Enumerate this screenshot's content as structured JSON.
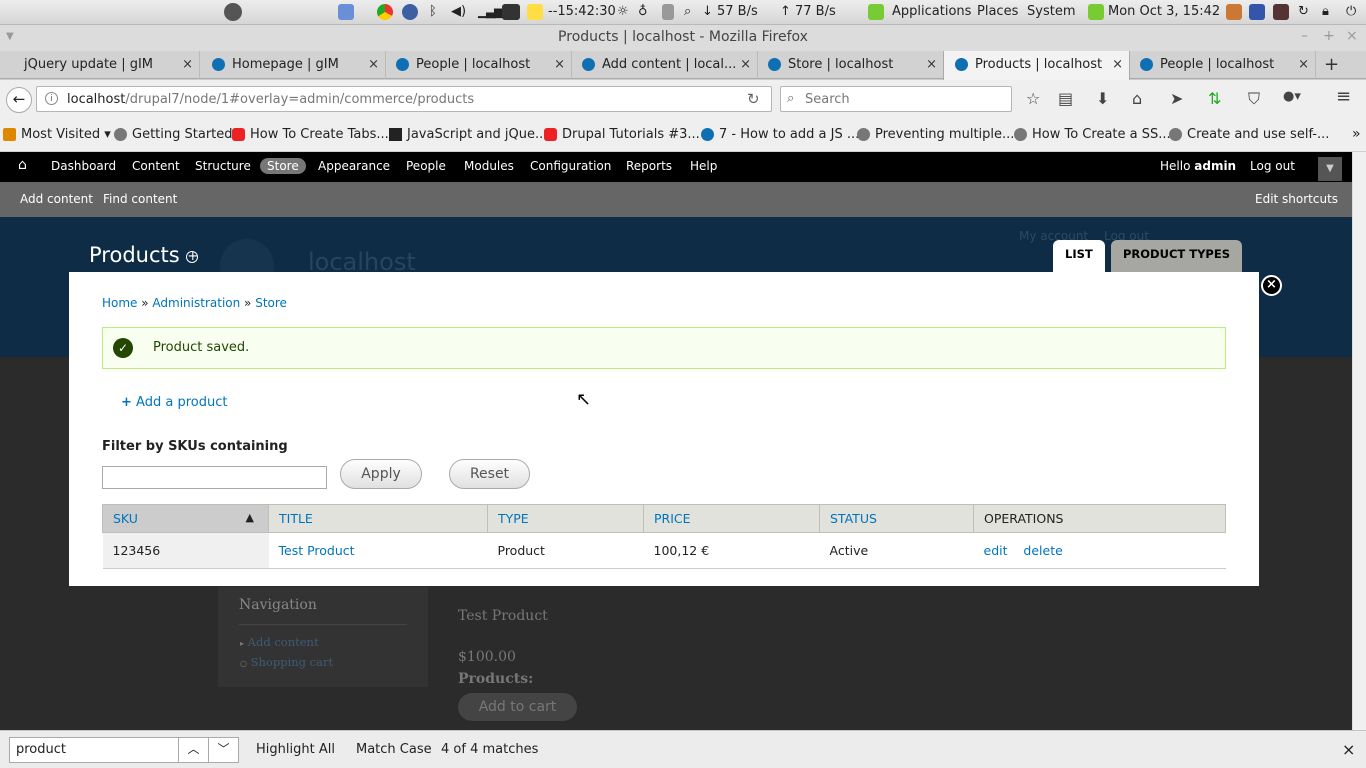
{
  "system": {
    "clock_left": "--15:42:30",
    "net_down": "57 B/s",
    "net_up": "77 B/s",
    "menu": [
      "Applications",
      "Places",
      "System"
    ],
    "datetime": "Mon Oct  3, 15:42"
  },
  "window": {
    "title": "Products | localhost - Mozilla Firefox"
  },
  "tabs": [
    {
      "label": "jQuery update | gIM"
    },
    {
      "label": "Homepage | gIM"
    },
    {
      "label": "People | localhost"
    },
    {
      "label": "Add content | local..."
    },
    {
      "label": "Store | localhost"
    },
    {
      "label": "Products | localhost"
    },
    {
      "label": "People | localhost"
    }
  ],
  "browser": {
    "url_host": "localhost",
    "url_path": "/drupal7/node/1#overlay=admin/commerce/products",
    "search_placeholder": "Search"
  },
  "bookmarks": [
    "Most Visited",
    "Getting Started",
    "How To Create Tabs...",
    "JavaScript and jQue...",
    "Drupal Tutorials #3...",
    "7 - How to add a JS ...",
    "Preventing multiple...",
    "How To Create a SS...",
    "Create and use self-..."
  ],
  "toolbar": {
    "items": [
      "Dashboard",
      "Content",
      "Structure",
      "Store",
      "Appearance",
      "People",
      "Modules",
      "Configuration",
      "Reports",
      "Help"
    ],
    "hello": "Hello",
    "user": "admin",
    "logout": "Log out"
  },
  "shortcuts": {
    "items": [
      "Add content",
      "Find content"
    ],
    "edit": "Edit shortcuts"
  },
  "site": {
    "name": "localhost",
    "my_account": "My account",
    "logout": "Log out"
  },
  "overlay": {
    "title": "Products",
    "tabs": [
      "LIST",
      "PRODUCT TYPES"
    ],
    "close": "×",
    "breadcrumb": [
      "Home",
      "Administration",
      "Store"
    ],
    "message": "Product saved.",
    "add_link": "Add a product",
    "filter_label": "Filter by SKUs containing",
    "filter_value": "",
    "apply": "Apply",
    "reset": "Reset",
    "table": {
      "headers": [
        "SKU",
        "TITLE",
        "TYPE",
        "PRICE",
        "STATUS",
        "OPERATIONS"
      ],
      "rows": [
        {
          "sku": "123456",
          "title": "Test Product",
          "type": "Product",
          "price": "100,12 €",
          "status": "Active",
          "edit": "edit",
          "delete": "delete"
        }
      ]
    }
  },
  "background_page": {
    "nav_title": "Navigation",
    "nav_items": [
      "Add content",
      "Shopping cart"
    ],
    "node_title": "Test Product",
    "price": "$100.00",
    "products_label": "Products:",
    "add_to_cart": "Add to cart"
  },
  "findbar": {
    "query": "product",
    "highlight": "Highlight All",
    "match_case": "Match Case",
    "status": "4 of 4 matches"
  }
}
